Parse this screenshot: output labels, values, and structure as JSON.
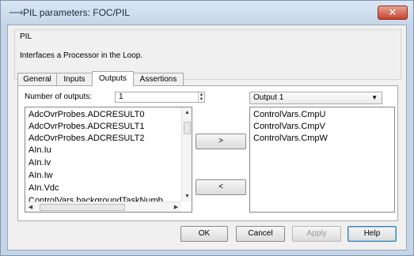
{
  "window": {
    "title": "PIL parameters: FOC/PIL",
    "icon": "pil-block-icon",
    "close_glyph": "✕"
  },
  "group": {
    "legend": "PIL",
    "description": "Interfaces a Processor in the Loop."
  },
  "tabs": [
    {
      "label": "General",
      "active": false
    },
    {
      "label": "Inputs",
      "active": false
    },
    {
      "label": "Outputs",
      "active": true
    },
    {
      "label": "Assertions",
      "active": false
    }
  ],
  "outputs_panel": {
    "num_outputs_label": "Number of outputs:",
    "num_outputs_value": "1",
    "available_signals": [
      "AdcOvrProbes.ADCRESULT0",
      "AdcOvrProbes.ADCRESULT1",
      "AdcOvrProbes.ADCRESULT2",
      "AIn.Iu",
      "AIn.Iv",
      "AIn.Iw",
      "AIn.Vdc",
      "ControlVars.backgroundTaskNumb"
    ],
    "add_button_label": ">",
    "remove_button_label": "<",
    "output_select": {
      "selected": "Output 1"
    },
    "selected_signals": [
      "ControlVars.CmpU",
      "ControlVars.CmpV",
      "ControlVars.CmpW"
    ]
  },
  "footer": {
    "ok_label": "OK",
    "cancel_label": "Cancel",
    "apply_label": "Apply",
    "help_label": "Help"
  },
  "colors": {
    "frame": "#c5d4e6",
    "close_button": "#c7432d",
    "help_focus": "#3c7fb1"
  }
}
